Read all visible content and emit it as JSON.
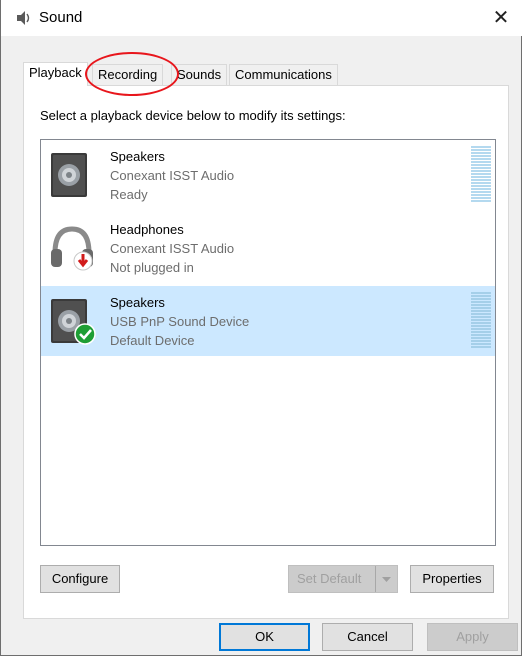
{
  "window": {
    "title": "Sound",
    "close_glyph": "✕"
  },
  "tabs": [
    {
      "label": "Playback",
      "active": true
    },
    {
      "label": "Recording",
      "active": false
    },
    {
      "label": "Sounds",
      "active": false
    },
    {
      "label": "Communications",
      "active": false
    }
  ],
  "panel": {
    "instruction": "Select a playback device below to modify its settings:"
  },
  "devices": [
    {
      "name": "Speakers",
      "driver": "Conexant ISST Audio",
      "status": "Ready",
      "icon": "speaker-icon",
      "selected": false
    },
    {
      "name": "Headphones",
      "driver": "Conexant ISST Audio",
      "status": "Not plugged in",
      "icon": "headphones-icon",
      "selected": false
    },
    {
      "name": "Speakers",
      "driver": "USB PnP Sound Device",
      "status": "Default Device",
      "icon": "speaker-icon",
      "selected": true
    }
  ],
  "buttons": {
    "configure": "Configure",
    "set_default": "Set Default",
    "properties": "Properties",
    "ok": "OK",
    "cancel": "Cancel",
    "apply": "Apply"
  },
  "colors": {
    "selection": "#cce8ff",
    "annotation": "#e8161c",
    "default_check": "#1e9e35",
    "unplugged_arrow": "#d11a1a",
    "focus_border": "#0078d7"
  }
}
